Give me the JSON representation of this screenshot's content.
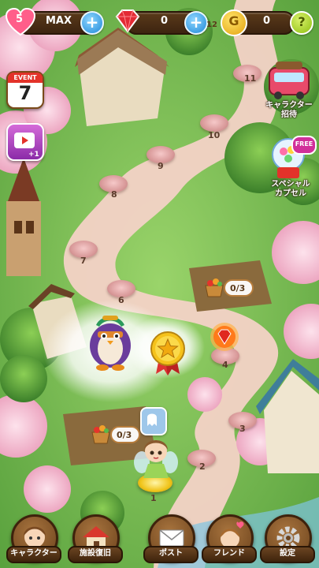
{
  "status": {
    "lives": "5",
    "lives_state": "MAX",
    "gems": "0",
    "gem_level": "12",
    "coins": "0"
  },
  "help_glyph": "?",
  "plus_glyph": "+",
  "left_buttons": {
    "event_label": "EVENT",
    "event_number": "7",
    "video_bonus": "+1"
  },
  "right_buttons": {
    "character_invite_label": "キャラクター\n招待",
    "capsule_label": "スペシャル\nカプセル",
    "capsule_badge": "FREE"
  },
  "stage_numbers": [
    "1",
    "2",
    "3",
    "4",
    "6",
    "7",
    "8",
    "9",
    "10",
    "11"
  ],
  "map_counters": [
    {
      "text": "0/3"
    },
    {
      "text": "0/3"
    }
  ],
  "bottom_nav": [
    {
      "label": "キャラクター",
      "icon": "character-icon"
    },
    {
      "label": "施設復旧",
      "icon": "house-icon"
    },
    {
      "label": "ポスト",
      "icon": "mail-icon"
    },
    {
      "label": "フレンド",
      "icon": "friend-icon"
    },
    {
      "label": "設定",
      "icon": "gear-icon"
    }
  ],
  "colors": {
    "path": "#f3d2c6",
    "grass": "#7cc25a",
    "blossom": "#f7b8cf",
    "accent_blue": "#1e88d8",
    "gold": "#f5c21b"
  }
}
